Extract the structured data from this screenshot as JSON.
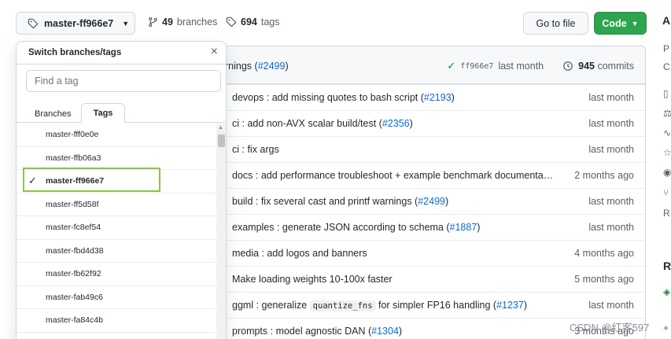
{
  "topbar": {
    "branch_label": "master-ff966e7",
    "branches_count": "49",
    "branches_label": "branches",
    "tags_count": "694",
    "tags_label": "tags",
    "go_to_file": "Go to file",
    "code_label": "Code",
    "about_heading": "A"
  },
  "latest_commit": {
    "message_prefix": "rnings (",
    "message_link": "#2499",
    "message_suffix": ")",
    "sha": "ff966e7",
    "age": "last month",
    "commits_count": "945",
    "commits_label": "commits"
  },
  "rows": [
    {
      "pre": "devops : add missing quotes to bash script (",
      "link": "#2193",
      "post": ")",
      "age": "last month"
    },
    {
      "pre": "ci : add non-AVX scalar build/test (",
      "link": "#2356",
      "post": ")",
      "age": "last month"
    },
    {
      "pre": "ci : fix args",
      "link": "",
      "post": "",
      "age": "last month"
    },
    {
      "pre": "docs : add performance troubleshoot + example benchmark documenta…",
      "link": "",
      "post": "",
      "age": "2 months ago"
    },
    {
      "pre": "build : fix several cast and printf warnings (",
      "link": "#2499",
      "post": ")",
      "age": "last month"
    },
    {
      "pre": "examples : generate JSON according to schema (",
      "link": "#1887",
      "post": ")",
      "age": "last month"
    },
    {
      "pre": "media : add logos and banners",
      "link": "",
      "post": "",
      "age": "4 months ago"
    },
    {
      "pre": "Make loading weights 10-100x faster",
      "link": "",
      "post": "",
      "age": "5 months ago"
    },
    {
      "pre": "ggml : generalize ",
      "code": "quantize_fns",
      "mid": " for simpler FP16 handling (",
      "link": "#1237",
      "post": ")",
      "age": "last month"
    },
    {
      "pre": "prompts : model agnostic DAN (",
      "link": "#1304",
      "post": ")",
      "age": "3 months ago"
    }
  ],
  "dropdown": {
    "title": "Switch branches/tags",
    "filter_placeholder": "Find a tag",
    "tab_branches": "Branches",
    "tab_tags": "Tags",
    "tags": [
      {
        "name": "master-fff0e0e",
        "selected": false
      },
      {
        "name": "master-ffb06a3",
        "selected": false
      },
      {
        "name": "master-ff966e7",
        "selected": true
      },
      {
        "name": "master-ff5d58f",
        "selected": false
      },
      {
        "name": "master-fc8ef54",
        "selected": false
      },
      {
        "name": "master-fbd4d38",
        "selected": false
      },
      {
        "name": "master-fb62f92",
        "selected": false
      },
      {
        "name": "master-fab49c6",
        "selected": false
      },
      {
        "name": "master-fa84c4b",
        "selected": false
      }
    ]
  },
  "sidebar_glyphs": [
    "P",
    "C",
    "R",
    "R",
    "+"
  ],
  "watermark": "CSDN @红客597",
  "colors": {
    "accent": "#0969da",
    "code_button": "#2da44e",
    "highlight_box": "#8bc34a",
    "success": "#1a7f37"
  }
}
